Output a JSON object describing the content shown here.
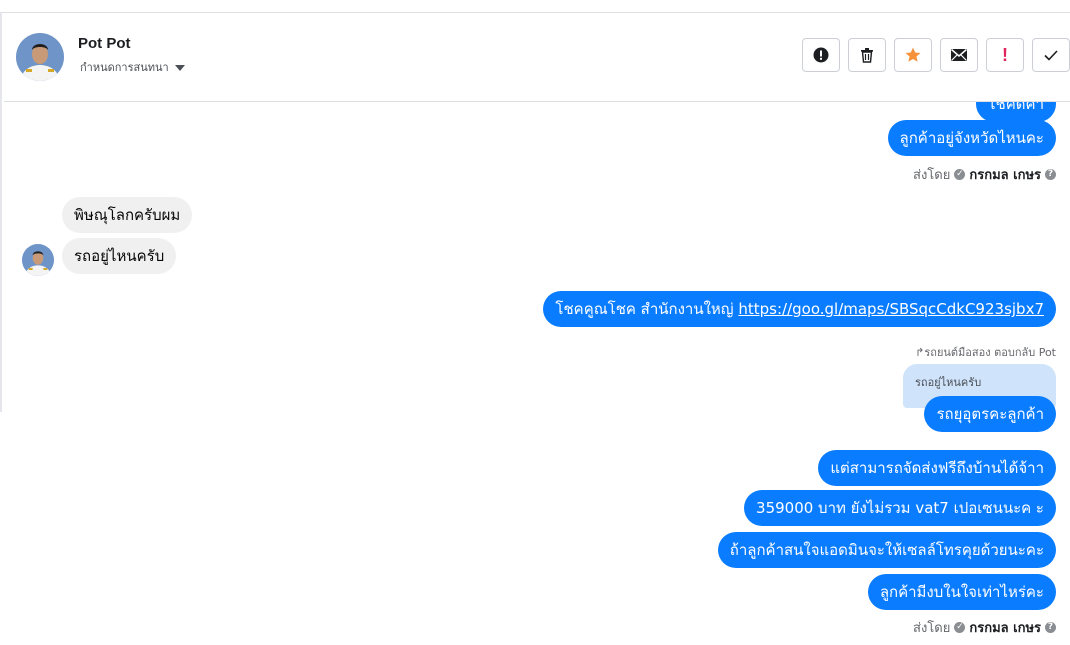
{
  "header": {
    "contact_name": "Pot Pot",
    "subtitle": "กำหนดการสนทนา",
    "actions": [
      {
        "name": "report-icon",
        "label": ""
      },
      {
        "name": "trash-icon",
        "label": ""
      },
      {
        "name": "star-icon",
        "label": ""
      },
      {
        "name": "envelope-icon",
        "label": ""
      },
      {
        "name": "spam-icon",
        "label": "!"
      },
      {
        "name": "check-icon",
        "label": ""
      }
    ],
    "colors": {
      "star": "#f7923b",
      "spam": "#e0245e",
      "accent": "#0a7cff"
    }
  },
  "messages": {
    "partial_top": "โชคดีค่า",
    "m1": "ลูกค้าอยู่จังหวัดไหนคะ",
    "meta1": {
      "prefix": "ส่งโดย",
      "sender": "กรกมล เกษร"
    },
    "in1": "พิษณุโลกครับผม",
    "in2": "รถอยู่ไหนครับ",
    "m2_text": "โชคคูณโชค สำนักงานใหญ่ ",
    "m2_link": "https://goo.gl/maps/SBSqcCdkC923sjbx7",
    "reply_label": "รถยนต์มือสอง ตอบกลับ Pot",
    "quoted": "รถอยู่ไหนครับ",
    "m3": "รถยุอุตรคะลูกค้า",
    "m4": "แต่สามารถจัดส่งฟรีถึงบ้านได้จ้าา",
    "m5": "359000 บาท ยังไม่รวม vat7 เปอเซนนะค ะ",
    "m6": "ถ้าลูกค้าสนใจแอดมินจะให้เซลล์โทรคุยด้วยนะคะ",
    "m7": "ลูกค้ามีงบในใจเท่าไหร่คะ",
    "meta2": {
      "prefix": "ส่งโดย",
      "sender": "กรกมล เกษร"
    }
  }
}
